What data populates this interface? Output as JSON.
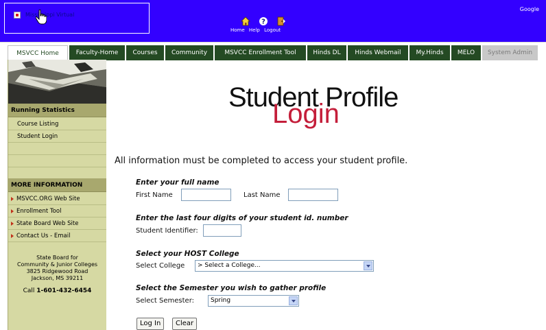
{
  "header": {
    "google_label": "Google",
    "logo_alt": "Mississippi Virtual",
    "links": [
      {
        "label": "Home",
        "icon": "home-icon"
      },
      {
        "label": "Help",
        "icon": "help-icon"
      },
      {
        "label": "Logout",
        "icon": "logout-icon"
      }
    ]
  },
  "tabs": [
    {
      "label": "MSVCC Home"
    },
    {
      "label": "Faculty-Home"
    },
    {
      "label": "Courses"
    },
    {
      "label": "Community"
    },
    {
      "label": "MSVCC Enrollment Tool"
    },
    {
      "label": "Hinds DL"
    },
    {
      "label": "Hinds Webmail"
    },
    {
      "label": "My.Hinds"
    },
    {
      "label": "MELO"
    },
    {
      "label": "System Admin"
    }
  ],
  "sidebar": {
    "section1_title": "Running Statistics",
    "section1_items": [
      "Course Listing",
      "Student Login"
    ],
    "section2_title": "MORE INFORMATION",
    "section2_items": [
      "MSVCC.ORG Web Site",
      "Enrollment Tool",
      "State Board Web Site",
      "Contact Us - Email"
    ],
    "contact": {
      "line1": "State Board for",
      "line2": "Community & Junior Colleges",
      "line3": "3825 Ridgewood Road",
      "line4": "Jackson, MS 39211",
      "phone_prefix": "Call ",
      "phone": "1-601-432-6454"
    }
  },
  "main": {
    "title": "Student Profile",
    "subtitle": "Login",
    "instructions": "All information must be completed to access your student profile.",
    "name_heading": "Enter your full name",
    "first_name_label": "First Name",
    "last_name_label": "Last Name",
    "id_heading": "Enter the last four digits of your student id. number",
    "id_label": "Student Identifier:",
    "college_heading": "Select your HOST College",
    "college_label": "Select College",
    "college_value": "> Select a College...",
    "semester_heading": "Select the Semester you wish to gather profile",
    "semester_label": "Select Semester:",
    "semester_value": "Spring",
    "login_button": "Log In",
    "clear_button": "Clear"
  }
}
